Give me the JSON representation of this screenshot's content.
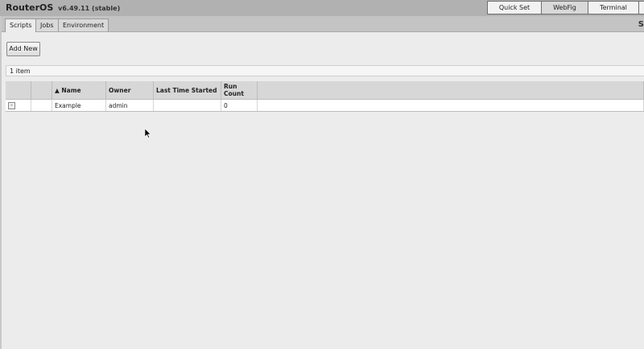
{
  "header": {
    "app_name": "RouterOS",
    "version": "v6.49.11 (stable)",
    "nav": [
      "Quick Set",
      "WebFig",
      "Terminal"
    ],
    "active_nav": "WebFig"
  },
  "tabs": [
    "Scripts",
    "Jobs",
    "Environment"
  ],
  "active_tab": "Scripts",
  "edge_text": "S",
  "toolbar": {
    "add_new_label": "Add New"
  },
  "list": {
    "item_count": "1 item",
    "columns": [
      "",
      "",
      "▲ Name",
      "Owner",
      "Last Time Started",
      "Run Count"
    ],
    "rows": [
      {
        "toggle": "-",
        "flag": "",
        "name": "Example",
        "owner": "admin",
        "last_time_started": "",
        "run_count": "0"
      }
    ]
  },
  "colors": {
    "header_bg": "#b1b1b1",
    "tabsbar_bg": "#c4c4c4",
    "page_bg": "#ececec"
  }
}
